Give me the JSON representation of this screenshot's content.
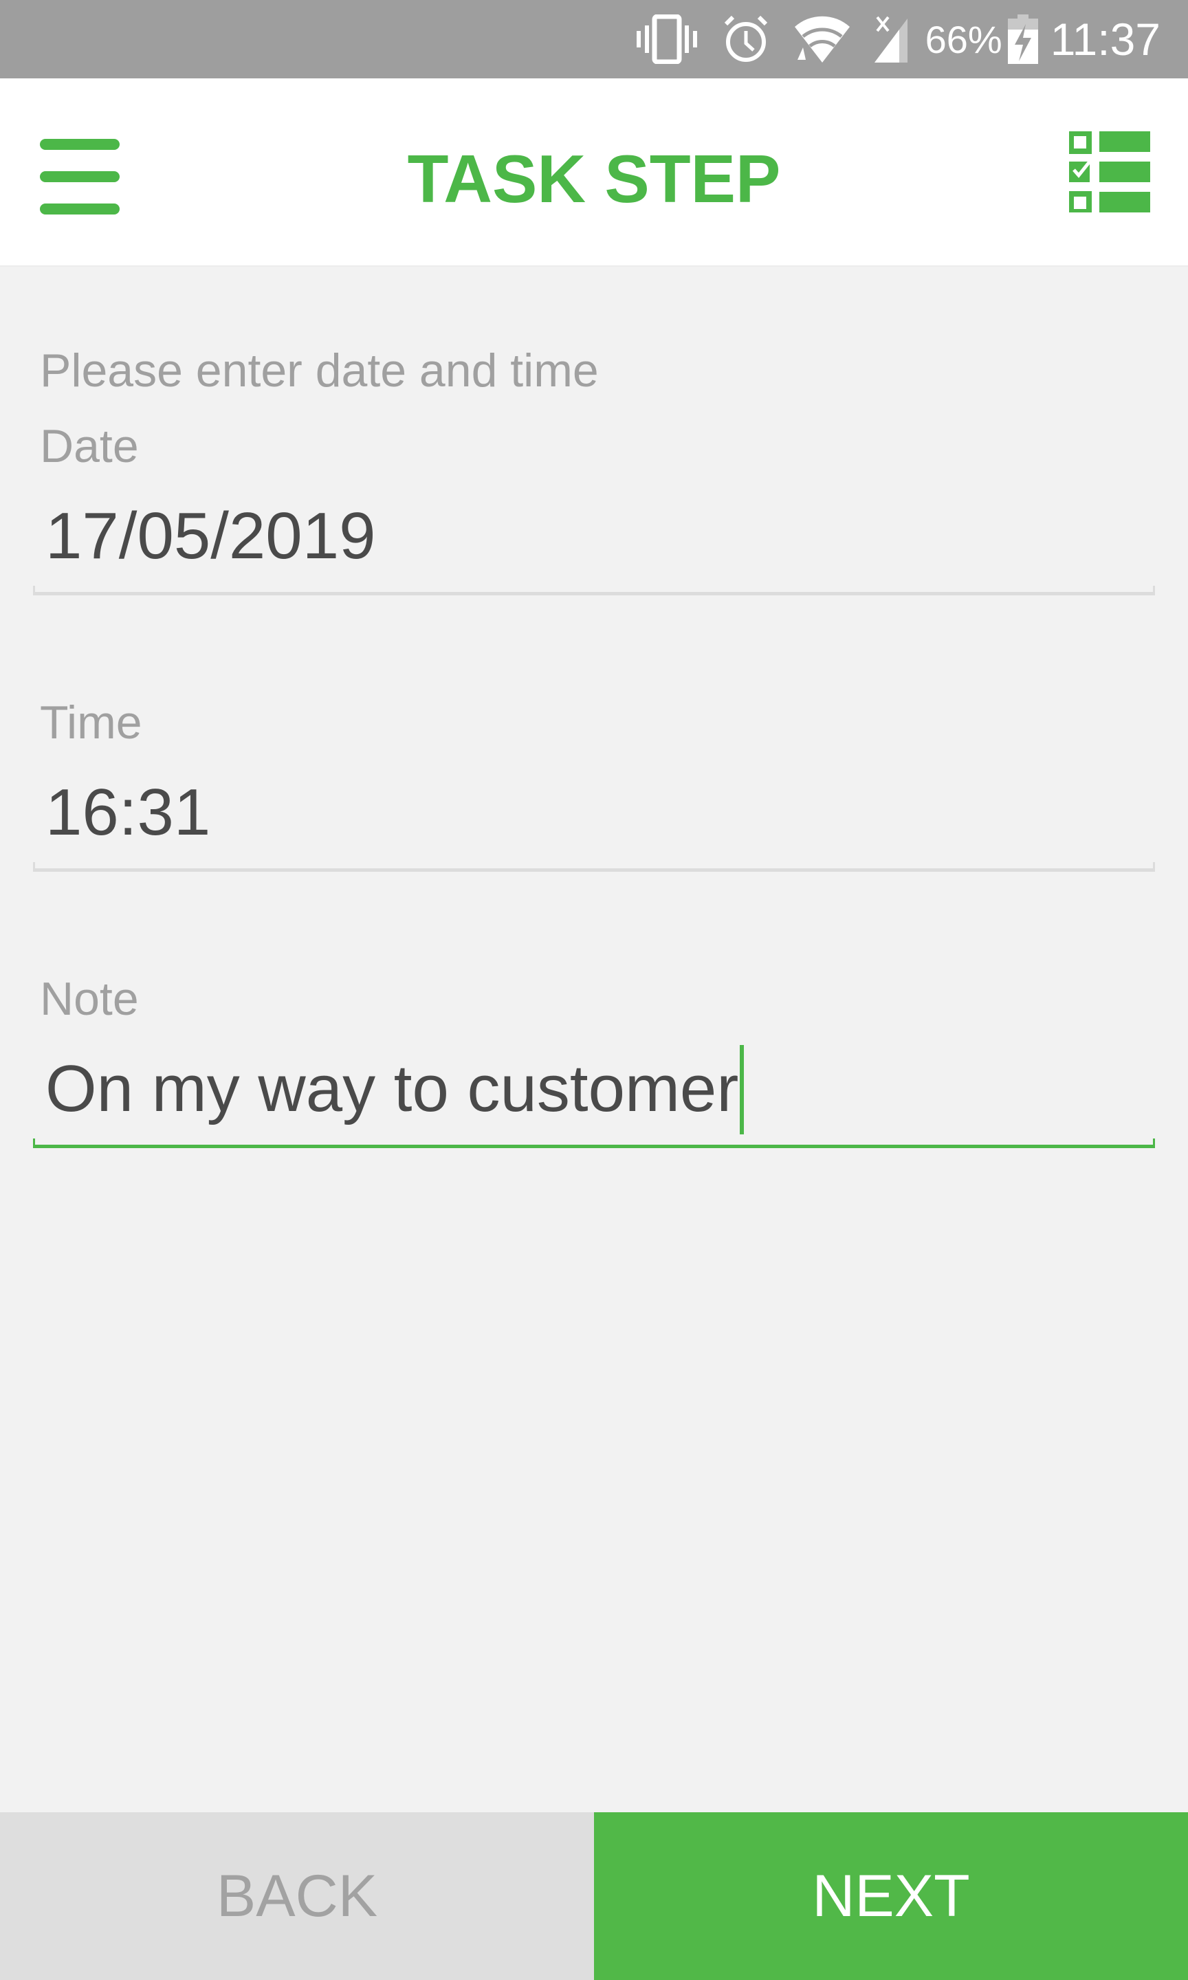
{
  "status_bar": {
    "icons": [
      "vibrate-icon",
      "alarm-icon",
      "wifi-icon",
      "cell-signal-no-data-icon",
      "battery-charging-icon"
    ],
    "battery_percent": "66%",
    "clock": "11:37"
  },
  "app_bar": {
    "menu_icon": "hamburger-menu-icon",
    "title": "TASK STEP",
    "action_icon": "checklist-icon"
  },
  "form": {
    "prompt": "Please enter date and time",
    "date": {
      "label": "Date",
      "value": "17/05/2019"
    },
    "time": {
      "label": "Time",
      "value": "16:31"
    },
    "note": {
      "label": "Note",
      "value": "On my way to customer",
      "focused": true
    }
  },
  "buttons": {
    "back_label": "BACK",
    "next_label": "NEXT"
  },
  "colors": {
    "accent": "#4cb748",
    "next_button": "#51b848",
    "back_button": "#dedede",
    "status_bar": "#9e9e9e",
    "background": "#f2f2f2"
  }
}
